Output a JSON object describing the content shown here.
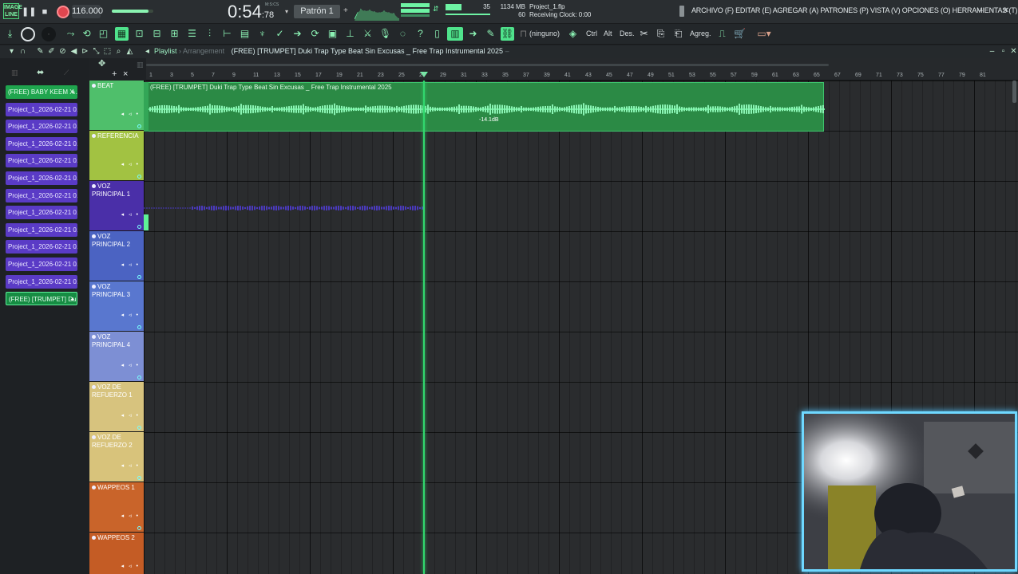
{
  "transport": {
    "logo_text": "IMAGE LINE",
    "tempo": "116.000",
    "time_main": "0:54",
    "time_sub": ":78",
    "time_unit": "M:S:CS",
    "pattern": "Patrón 1",
    "cpu_value": "35",
    "memory": "1134 MB",
    "polyphony": "60",
    "project_file": "Project_1.flp",
    "clock_status": "Receiving Clock: 0:00"
  },
  "menu": {
    "items": "ARCHIVO (F)  EDITAR (E)  AGREGAR (A)  PATRONES (P)  VISTA (V)  OPCIONES (O)  HERRAMIENTAS (T)  AYUDA"
  },
  "toolbar": {
    "midi_device": "(ninguno)",
    "ctrl_label": "Ctrl",
    "alt_label": "Alt",
    "des_label": "Des.",
    "agreg_label": "Agreg."
  },
  "playlist": {
    "title": "Playlist",
    "view_mode": "Arrangement",
    "song_name": "(FREE) [TRUMPET] Duki Trap Type Beat Sin Excusas _ Free Trap Instrumental 2025"
  },
  "ruler": {
    "ticks": [
      "1",
      "3",
      "5",
      "7",
      "9",
      "11",
      "13",
      "15",
      "17",
      "19",
      "21",
      "23",
      "25",
      "27",
      "29",
      "31",
      "33",
      "35",
      "37",
      "39",
      "41",
      "43",
      "45",
      "47",
      "49",
      "51",
      "53",
      "55",
      "57",
      "59",
      "61",
      "63",
      "65",
      "67",
      "69",
      "71",
      "73",
      "75",
      "77",
      "79",
      "81"
    ]
  },
  "picker": {
    "clips": [
      {
        "label": "(FREE) BABY KEEM X...",
        "style": "green"
      },
      {
        "label": "Project_1_2026-02-21 0...",
        "style": "purple"
      },
      {
        "label": "Project_1_2026-02-21 0...",
        "style": "purple"
      },
      {
        "label": "Project_1_2026-02-21 0...",
        "style": "purple"
      },
      {
        "label": "Project_1_2026-02-21 0...",
        "style": "purple"
      },
      {
        "label": "Project_1_2026-02-21 0...",
        "style": "purple"
      },
      {
        "label": "Project_1_2026-02-21 0...",
        "style": "purple"
      },
      {
        "label": "Project_1_2026-02-21 0...",
        "style": "purple"
      },
      {
        "label": "Project_1_2026-02-21 0...",
        "style": "purple"
      },
      {
        "label": "Project_1_2026-02-21 0...",
        "style": "purple"
      },
      {
        "label": "Project_1_2026-02-21 0...",
        "style": "purple"
      },
      {
        "label": "Project_1_2026-02-21 0...",
        "style": "purple"
      },
      {
        "label": "(FREE) [TRUMPET] Du...",
        "style": "sel"
      }
    ]
  },
  "tracks": [
    {
      "name": "BEAT",
      "color": "#4fbf6b"
    },
    {
      "name": "REFERENCIA",
      "color": "#a2c242"
    },
    {
      "name": "VOZ PRINCIPAL 1",
      "color": "#4a2fa8"
    },
    {
      "name": "VOZ PRINCIPAL 2",
      "color": "#4b63c2"
    },
    {
      "name": "VOZ PRINCIPAL 3",
      "color": "#5977cf"
    },
    {
      "name": "VOZ PRINCIPAL 4",
      "color": "#7d8fd4"
    },
    {
      "name": "VOZ DE REFUERZO 1",
      "color": "#d7c37e"
    },
    {
      "name": "VOZ DE REFUERZO 2",
      "color": "#d8c37b"
    },
    {
      "name": "WAPPEOS 1",
      "color": "#c9642a"
    },
    {
      "name": "WAPPEOS 2",
      "color": "#c45c25"
    }
  ],
  "clips_on_grid": {
    "beat_title": "(FREE) [TRUMPET] Duki Trap Type Beat Sin Excusas _ Free Trap Instrumental 2025",
    "beat_gain": "-14.1dB"
  },
  "colors": {
    "accent": "#4fe38c",
    "playhead": "#31d76d",
    "webcam_border": "#6fd8ff"
  }
}
